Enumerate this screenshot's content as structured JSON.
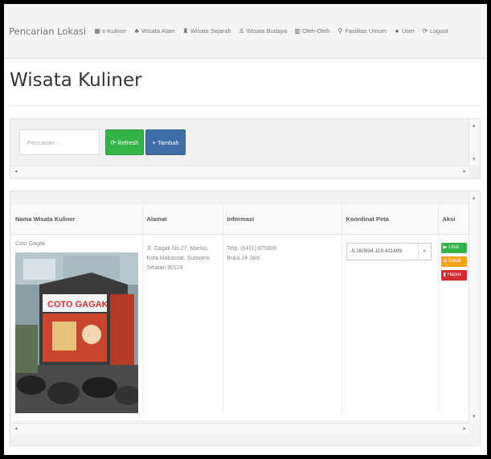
{
  "navbar": {
    "brand": "Pencarian Lokasi",
    "items": [
      {
        "label": "e-Kuliner",
        "icon": "grid-icon",
        "glyph": "▦"
      },
      {
        "label": "Wisata Alam",
        "icon": "tree-icon",
        "glyph": "♣"
      },
      {
        "label": "Wisata Sejarah",
        "icon": "monument-icon",
        "glyph": "♜"
      },
      {
        "label": "Wisata Budaya",
        "icon": "person-icon",
        "glyph": "♙"
      },
      {
        "label": "Oleh-Oleh",
        "icon": "gift-icon",
        "glyph": "▥"
      },
      {
        "label": "Fasilitas Umum",
        "icon": "pin-icon",
        "glyph": "⚲"
      },
      {
        "label": "User",
        "icon": "user-icon",
        "glyph": "●"
      },
      {
        "label": "Logout",
        "icon": "logout-icon",
        "glyph": "⟳"
      }
    ]
  },
  "page": {
    "title": "Wisata Kuliner"
  },
  "toolbar": {
    "search_placeholder": "Pencarian ...",
    "refresh_label": "Refresh",
    "tambah_label": "Tambah"
  },
  "table": {
    "headers": [
      "Nama Wisata Kuliner",
      "Alamat",
      "Informasi",
      "Koordinat Peta",
      "Aksi"
    ],
    "rows": [
      {
        "name": "Coto Gagak",
        "alamat": "Jl. Gagak No.27, Mariso, Kota Makassar, Sulawesi Selatan 90124",
        "informasi_line1": "Telp. (0411) 870800",
        "informasi_line2": "Buka 24 Jam",
        "koordinat": "-5.160994,119.411499",
        "actions": {
          "lihat": "Lihat",
          "detail": "Detail",
          "hapus": "Hapus"
        },
        "photo_sign": "COTO GAGAK"
      }
    ]
  },
  "colors": {
    "refresh": "#33b349",
    "tambah": "#3f6ea6",
    "lihat": "#37b24a",
    "detail": "#f1a31e",
    "hapus": "#d22b2b"
  }
}
